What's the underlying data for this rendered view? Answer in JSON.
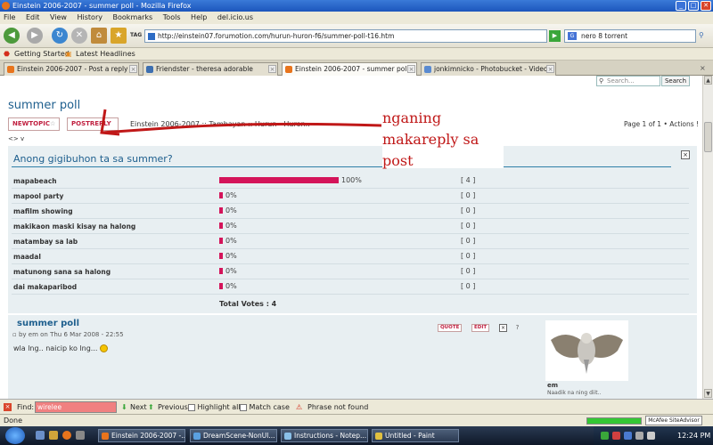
{
  "window": {
    "title": "Einstein 2006-2007 - summer poll - Mozilla Firefox"
  },
  "menu": [
    "File",
    "Edit",
    "View",
    "History",
    "Bookmarks",
    "Tools",
    "Help",
    "del.icio.us"
  ],
  "nav": {
    "url": "http://einstein07.forumotion.com/hurun-huron-f6/summer-poll-t16.htm",
    "search_value": "nero 8 torrent",
    "tag_label": "TAG"
  },
  "bookmarks": [
    "Getting Started",
    "Latest Headlines"
  ],
  "tabs": [
    {
      "label": "Einstein 2006-2007 - Post a reply"
    },
    {
      "label": "Friendster - theresa adorable"
    },
    {
      "label": "Einstein 2006-2007 - summer poll"
    },
    {
      "label": "jonkimnicko - Photobucket - Video..."
    }
  ],
  "forum": {
    "search_placeholder": "Search...",
    "search_button": "Search",
    "page_title": "summer poll",
    "newtopic": "NEWTOPIC",
    "postreply": "POSTREPLY",
    "breadcrumb": "Einstein 2006-2007 :: Tambayan :: Hurun - Huron..",
    "pagination": "Page 1 of 1 • Actions !",
    "sort_glyph": "<> v",
    "annotation": [
      "nganing",
      "makareply sa",
      "post"
    ],
    "poll": {
      "question": "Anong gigibuhon ta sa summer?",
      "options": [
        {
          "label": "mapabeach",
          "percent": 100,
          "percent_label": "100%",
          "count": "[ 4 ]"
        },
        {
          "label": "mapool party",
          "percent": 0,
          "percent_label": "0%",
          "count": "[ 0 ]"
        },
        {
          "label": "mafilm showing",
          "percent": 0,
          "percent_label": "0%",
          "count": "[ 0 ]"
        },
        {
          "label": "makikaon maski kisay na halong",
          "percent": 0,
          "percent_label": "0%",
          "count": "[ 0 ]"
        },
        {
          "label": "matambay sa lab",
          "percent": 0,
          "percent_label": "0%",
          "count": "[ 0 ]"
        },
        {
          "label": "maadal",
          "percent": 0,
          "percent_label": "0%",
          "count": "[ 0 ]"
        },
        {
          "label": "matunong sana sa halong",
          "percent": 0,
          "percent_label": "0%",
          "count": "[ 0 ]"
        },
        {
          "label": "dai makaparibod",
          "percent": 0,
          "percent_label": "0%",
          "count": "[ 0 ]"
        }
      ],
      "total_votes": "Total Votes : 4"
    },
    "post": {
      "title": "summer poll",
      "meta": "by em on Thu 6 Mar 2008 - 22:55",
      "body": "wla lng.. naicip ko lng...",
      "quote": "QUOTE",
      "edit": "EDIT",
      "author": "em",
      "author_sub": "Naadik na ning diit.."
    }
  },
  "findbar": {
    "label": "Find:",
    "value": "wirelee",
    "next": "Next",
    "previous": "Previous",
    "highlight": "Highlight all",
    "matchcase": "Match case",
    "status": "Phrase not found"
  },
  "status": {
    "text": "Done",
    "mcafee": "McAfee SiteAdvisor",
    "progress": 1.0
  },
  "taskbar": {
    "items": [
      "Einstein 2006-2007 -...",
      "DreamScene-NonUl...",
      "Instructions - Notep...",
      "Untitled - Paint"
    ],
    "clock": "12:24 PM"
  },
  "colors": {
    "accent": "#1e5f8e",
    "bar": "#d4145a",
    "annotation": "#c01818"
  }
}
